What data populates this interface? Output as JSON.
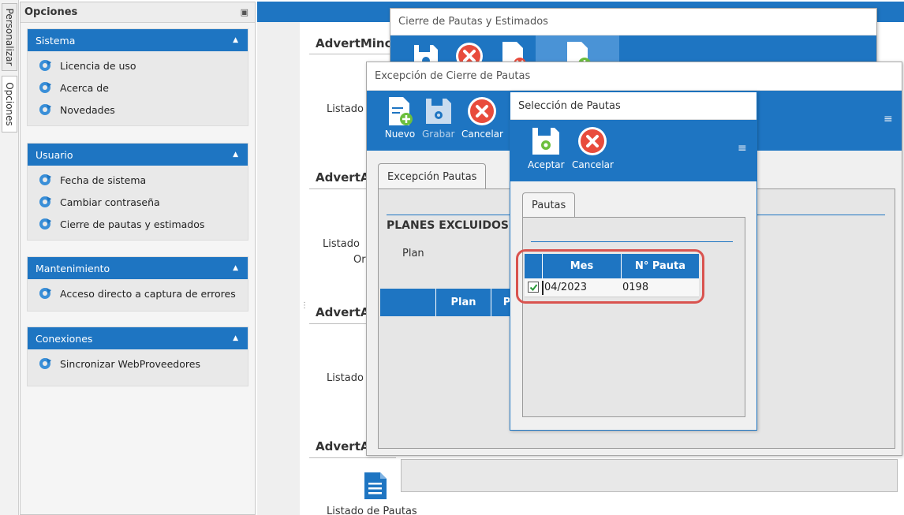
{
  "vertical_tabs": [
    "Personalizar",
    "Opciones"
  ],
  "panel": {
    "title": "Opciones",
    "groups": [
      {
        "title": "Sistema",
        "items": [
          "Licencia de uso",
          "Acerca de",
          "Novedades"
        ]
      },
      {
        "title": "Usuario",
        "items": [
          "Fecha de sistema",
          "Cambiar contraseña",
          "Cierre de pautas y estimados"
        ]
      },
      {
        "title": "Mantenimiento",
        "items": [
          "Acceso directo a captura de errores"
        ]
      },
      {
        "title": "Conexiones",
        "items": [
          "Sincronizar WebProveedores"
        ]
      }
    ]
  },
  "main": {
    "sections": [
      "AdvertMinc",
      "AdvertA",
      "AdvertA",
      "AdvertA"
    ],
    "labels": [
      "Listado",
      "Listado",
      "Or",
      "Listado",
      "Listado de Pautas"
    ]
  },
  "win_cierre": {
    "title": "Cierre de Pautas y Estimados"
  },
  "win_excepcion": {
    "title": "Excepción de Cierre de Pautas",
    "buttons": {
      "nuevo": "Nuevo",
      "grabar": "Grabar",
      "cancelar": "Cancelar"
    },
    "tab": "Excepción Pautas",
    "planes_title": "PLANES EXCLUIDOS",
    "plan_label": "Plan",
    "grid_cols": [
      "Plan",
      "P"
    ]
  },
  "win_seleccion": {
    "title": "Selección de Pautas",
    "buttons": {
      "aceptar": "Aceptar",
      "cancelar": "Cancelar"
    },
    "tab": "Pautas",
    "grid": {
      "columns": [
        "Mes",
        "N° Pauta"
      ],
      "rows": [
        {
          "checked": true,
          "mes": "04/2023",
          "pauta": "0198"
        }
      ]
    }
  },
  "colors": {
    "accent": "#1e75c2",
    "highlight": "#d9534f"
  }
}
